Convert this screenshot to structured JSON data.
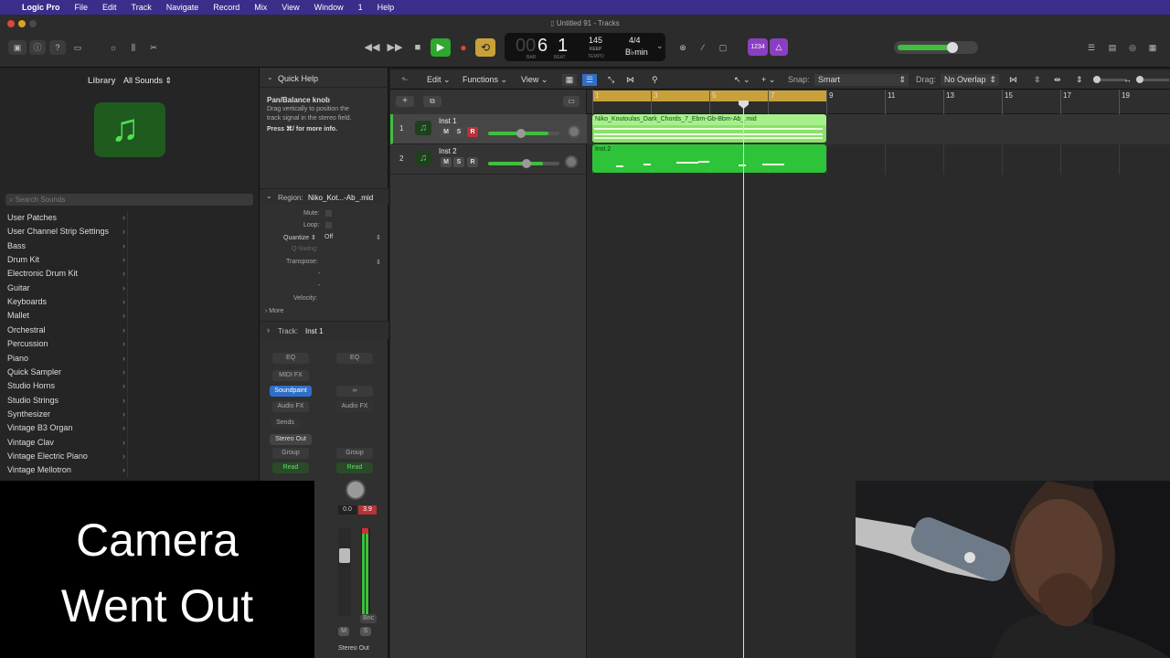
{
  "menubar": {
    "apple": "",
    "app": "Logic Pro",
    "items": [
      "File",
      "Edit",
      "Track",
      "Navigate",
      "Record",
      "Mix",
      "View",
      "Window",
      "1",
      "Help"
    ]
  },
  "window": {
    "title": "Untitled 91 - Tracks"
  },
  "lcd": {
    "bar": "6",
    "beat": "1",
    "bar_label": "BAR",
    "beat_label": "BEAT",
    "tempo": "145",
    "tempo_keep": "KEEP",
    "tempo_label": "TEMPO",
    "sig": "4/4",
    "key": "B♭min",
    "leading": "00"
  },
  "count_in": "1234",
  "library": {
    "title": "Library",
    "filter": "All Sounds",
    "search_placeholder": "Search Sounds",
    "items": [
      "User Patches",
      "User Channel Strip Settings",
      "Bass",
      "Drum Kit",
      "Electronic Drum Kit",
      "Guitar",
      "Keyboards",
      "Mallet",
      "Orchestral",
      "Percussion",
      "Piano",
      "Quick Sampler",
      "Studio Horns",
      "Studio Strings",
      "Synthesizer",
      "Vintage B3 Organ",
      "Vintage Clav",
      "Vintage Electric Piano",
      "Vintage Mellotron"
    ]
  },
  "quick_help": {
    "title": "Quick Help",
    "heading": "Pan/Balance knob",
    "line1": "Drag vertically to position the",
    "line2": "track signal in the stereo field.",
    "line3": "Press ⌘/ for more info."
  },
  "region_inspector": {
    "label": "Region:",
    "name": "Niko_Kot...-Ab_.mid",
    "mute": "Mute:",
    "loop": "Loop:",
    "quantize": "Quantize",
    "quantize_value": "Off",
    "qswing": "Q-Swing:",
    "transpose": "Transpose:",
    "velocity": "Velocity:",
    "more": "More",
    "dash": "-"
  },
  "track_inspector": {
    "label": "Track:",
    "name": "Inst 1"
  },
  "channel_strip": {
    "eq": "EQ",
    "midi_fx": "MIDI FX",
    "instrument": "Soundpaint",
    "audio_fx": "Audio FX",
    "sends": "Sends",
    "output": "Stereo Out",
    "group": "Group",
    "read": "Read",
    "pan_value": "0.0",
    "peak_value": "3.9",
    "bnc": "Bnc",
    "m": "M",
    "s": "S",
    "footer": "Stereo Out",
    "link": "∞"
  },
  "tracks_header": {
    "edit": "Edit",
    "functions": "Functions",
    "view": "View",
    "snap_label": "Snap:",
    "snap": "Smart",
    "drag_label": "Drag:",
    "drag": "No Overlap"
  },
  "tracks": [
    {
      "num": "1",
      "name": "Inst 1",
      "m": "M",
      "s": "S",
      "r": "R"
    },
    {
      "num": "2",
      "name": "Inst 2",
      "m": "M",
      "s": "S",
      "r": "R"
    }
  ],
  "ruler": [
    "1",
    "3",
    "5",
    "7",
    "9",
    "11",
    "13",
    "15",
    "17",
    "19"
  ],
  "regions": [
    {
      "name": "Niko_Koutoulas_Dark_Chords_7_Ebm-Gb-Bbm-Ab_.mid"
    },
    {
      "name": "Inst 2"
    }
  ],
  "overlay": {
    "line1": "Camera",
    "line2": "Went Out"
  },
  "colors": {
    "accent": "#3fbf3f",
    "region_light": "#a6f08c",
    "region": "#2ec43a",
    "cycle": "#c8a13a",
    "menubar": "#3a2e8a"
  }
}
